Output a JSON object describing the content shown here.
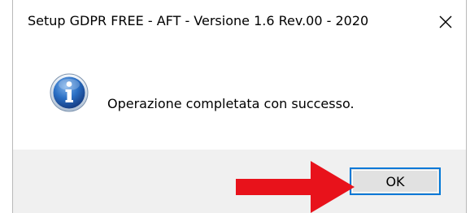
{
  "window": {
    "title": "Setup GDPR FREE - AFT - Versione 1.6 Rev.00 - 2020",
    "close_icon": "close-icon"
  },
  "dialog": {
    "icon": "info-icon",
    "message": "Operazione completata con successo."
  },
  "buttons": {
    "ok_label": "OK"
  },
  "annotation": {
    "icon": "red-arrow-icon",
    "color": "#e8121b"
  },
  "colors": {
    "button_focus_border": "#0078d7",
    "footer_background": "#f0f0f0",
    "info_icon_blue": "#2a6fc4"
  }
}
